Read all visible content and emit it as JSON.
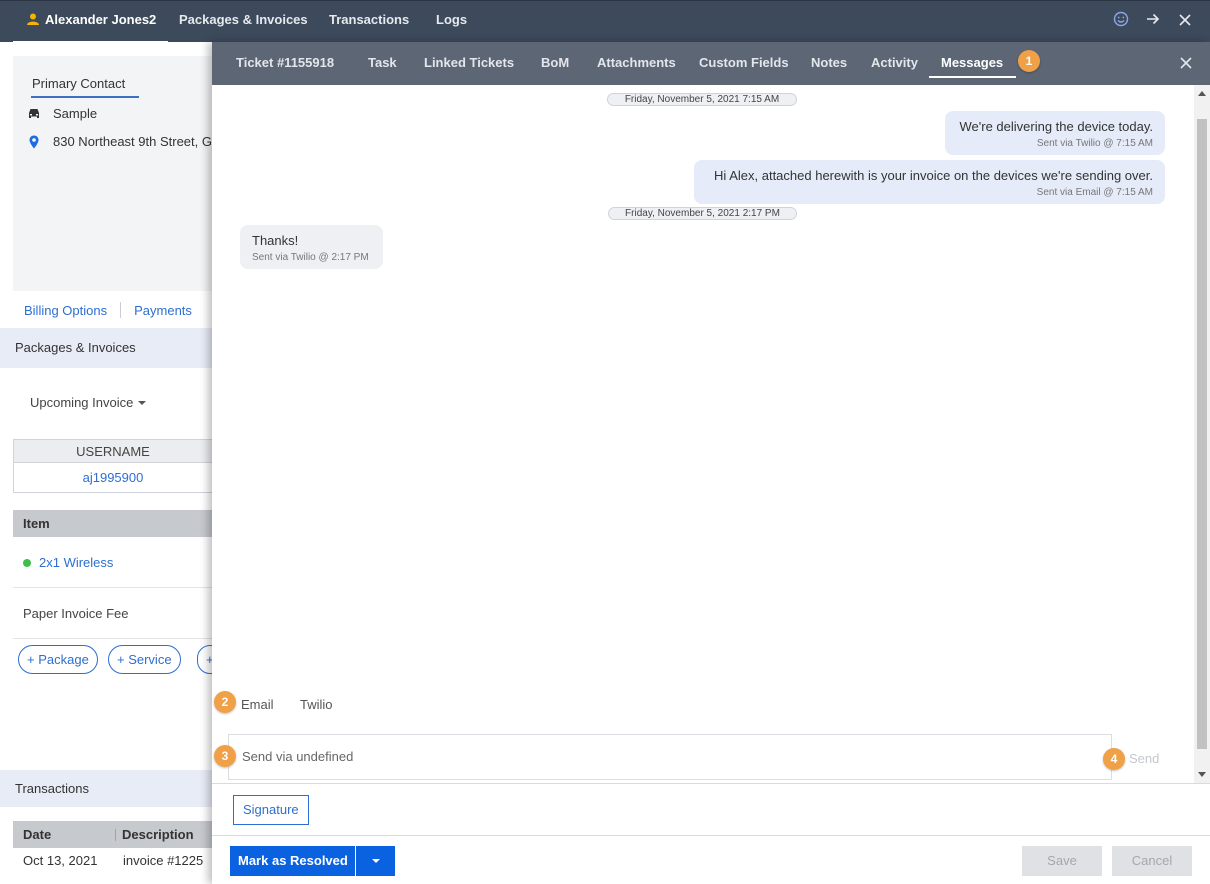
{
  "topbar": {
    "tabs": [
      {
        "label": "Alexander Jones2",
        "active": true
      },
      {
        "label": "Packages & Invoices",
        "active": false
      },
      {
        "label": "Transactions",
        "active": false
      },
      {
        "label": "Logs",
        "active": false
      }
    ],
    "icons": [
      "smiley-icon",
      "arrow-right-icon",
      "close-icon"
    ]
  },
  "background": {
    "primary_contact_label": "Primary Contact",
    "contact_name": "Sample",
    "contact_address": "830 Northeast 9th Street, G",
    "billing_options": "Billing Options",
    "payments": "Payments",
    "packages_header": "Packages & Invoices",
    "upcoming_invoice": "Upcoming Invoice",
    "username_header": "USERNAME",
    "username_value": "aj1995900",
    "item_header": "Item",
    "items": [
      "2x1 Wireless",
      "Paper Invoice Fee"
    ],
    "add_package": "+ Package",
    "add_service": "+ Service",
    "add_more": "+",
    "transactions_header": "Transactions",
    "trans_cols": [
      "Date",
      "Description"
    ],
    "trans_row": [
      "Oct 13, 2021",
      "invoice #1225"
    ]
  },
  "modal": {
    "tabs": [
      {
        "label": "Ticket #1155918"
      },
      {
        "label": "Task"
      },
      {
        "label": "Linked Tickets"
      },
      {
        "label": "BoM"
      },
      {
        "label": "Attachments"
      },
      {
        "label": "Custom Fields"
      },
      {
        "label": "Notes"
      },
      {
        "label": "Activity"
      },
      {
        "label": "Messages",
        "active": true
      }
    ],
    "badges": [
      "1",
      "2",
      "3",
      "4"
    ],
    "messages": [
      {
        "type": "date",
        "text": "Friday, November 5, 2021 7:15 AM"
      },
      {
        "type": "out",
        "text": "We're delivering the device today.",
        "meta": "Sent via Twilio @ 7:15 AM"
      },
      {
        "type": "out",
        "text": "Hi Alex, attached herewith is your invoice on the devices we're sending over.",
        "meta": "Sent via Email @ 7:15 AM"
      },
      {
        "type": "date",
        "text": "Friday, November 5, 2021 2:17 PM"
      },
      {
        "type": "in",
        "text": "Thanks!",
        "meta": "Sent via Twilio @ 2:17 PM"
      }
    ],
    "channels": [
      "Email",
      "Twilio"
    ],
    "compose_placeholder": "Send via undefined",
    "send_label": "Send",
    "signature_label": "Signature",
    "resolve_label": "Mark as Resolved",
    "save_label": "Save",
    "cancel_label": "Cancel"
  }
}
